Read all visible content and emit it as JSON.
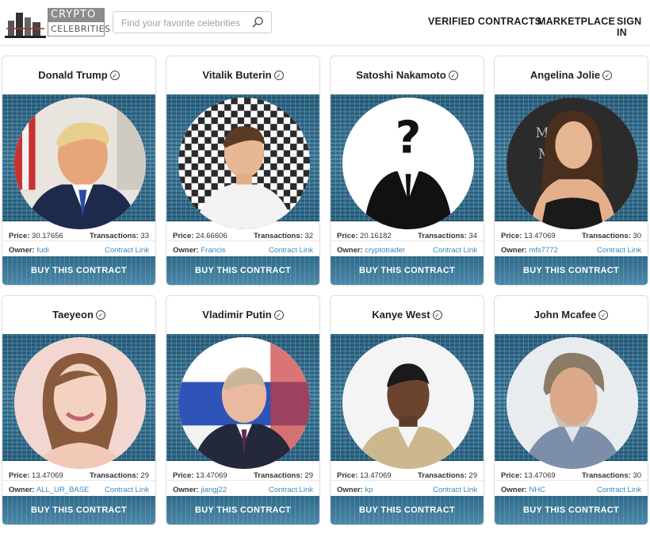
{
  "brand": {
    "line1": "CRYPTO",
    "line2": "CELEBRITIES"
  },
  "search": {
    "placeholder": "Find your favorite celebrities"
  },
  "nav": {
    "verified": "VERIFIED CONTRACTS",
    "marketplace": "MARKETPLACE",
    "signin": "SIGN IN"
  },
  "labels": {
    "price": "Price:",
    "transactions": "Transactions:",
    "owner": "Owner:",
    "contract": "Contract Link",
    "buy": "BUY THIS CONTRACT",
    "verified_mark": "✓"
  },
  "colors": {
    "accent": "#3a6f8f",
    "link": "#3f86b8"
  },
  "cards": [
    {
      "name": "Donald Trump",
      "price": "30.17656",
      "transactions": "33",
      "owner": "fudi"
    },
    {
      "name": "Vitalik Buterin",
      "price": "24.66606",
      "transactions": "32",
      "owner": "Francis"
    },
    {
      "name": "Satoshi Nakamoto",
      "price": "20.16182",
      "transactions": "34",
      "owner": "cryptotrader"
    },
    {
      "name": "Angelina Jolie",
      "price": "13.47069",
      "transactions": "30",
      "owner": "mfs7772"
    },
    {
      "name": "Taeyeon",
      "price": "13.47069",
      "transactions": "29",
      "owner": "ALL_UR_BASE"
    },
    {
      "name": "Vladimir Putin",
      "price": "13.47069",
      "transactions": "29",
      "owner": "jiangj22"
    },
    {
      "name": "Kanye West",
      "price": "13.47069",
      "transactions": "29",
      "owner": "kp"
    },
    {
      "name": "John Mcafee",
      "price": "13.47069",
      "transactions": "30",
      "owner": "NHC"
    }
  ]
}
